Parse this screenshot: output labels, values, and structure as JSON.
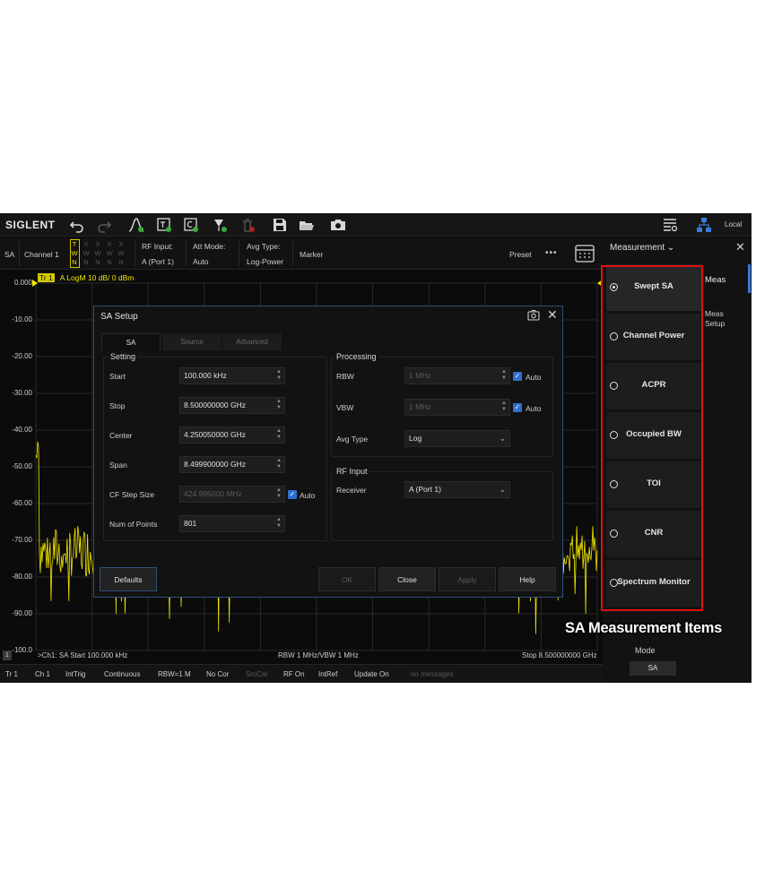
{
  "brand": "SIGLENT",
  "toolbar": {
    "local_label": "Local"
  },
  "channel_bar": {
    "mode": "SA",
    "channel": "Channel 1",
    "trace_grid": {
      "rows": [
        [
          "T",
          "X",
          "X",
          "X",
          "X"
        ],
        [
          "W",
          "W",
          "W",
          "W",
          "W"
        ],
        [
          "N",
          "N",
          "N",
          "N",
          "N"
        ]
      ],
      "active_column": 0
    },
    "rf_input_label": "RF Input:",
    "rf_input_value": "A (Port 1)",
    "att_mode_label": "Att Mode:",
    "att_mode_value": "Auto",
    "avg_type_label": "Avg Type:",
    "avg_type_value": "Log-Power",
    "marker_label": "Marker",
    "preset_label": "Preset",
    "more_label": "•••"
  },
  "trace_header": {
    "tag": "Tr 1",
    "text": "A  LogM  10 dB/  0 dBm"
  },
  "y_axis": {
    "ticks": [
      "0.000",
      "-10.00",
      "-20.00",
      "-30.00",
      "-40.00",
      "-50.00",
      "-60.00",
      "-70.00",
      "-80.00",
      "-90.00",
      "-100.0"
    ],
    "top_db": 0,
    "bottom_db": -100
  },
  "plot_footer": {
    "badge": "1",
    "start": ">Ch1: SA Start 100.000 kHz",
    "center": "RBW 1 MHz/VBW 1 MHz",
    "stop": "Stop 8.500000000 GHz"
  },
  "status_bar": [
    "Tr 1",
    "Ch 1",
    "IntTrig",
    "Continuous",
    "RBW=1 M",
    "No Cor",
    "SrcCal",
    "RF On",
    "IntRef",
    "Update On",
    "no messages"
  ],
  "dialog": {
    "title": "SA Setup",
    "tabs": [
      "SA",
      "Source",
      "Advanced"
    ],
    "setting": {
      "title": "Setting",
      "start_label": "Start",
      "start_value": "100.000 kHz",
      "stop_label": "Stop",
      "stop_value": "8.500000000 GHz",
      "center_label": "Center",
      "center_value": "4.250050000 GHz",
      "span_label": "Span",
      "span_value": "8.499900000 GHz",
      "cfstep_label": "CF Step Size",
      "cfstep_value": "424.995000 MHz",
      "cfstep_auto": "Auto",
      "points_label": "Num of Points",
      "points_value": "801"
    },
    "processing": {
      "title": "Processing",
      "rbw_label": "RBW",
      "rbw_value": "1 MHz",
      "rbw_auto": "Auto",
      "vbw_label": "VBW",
      "vbw_value": "1 MHz",
      "vbw_auto": "Auto",
      "avg_label": "Avg Type",
      "avg_value": "Log"
    },
    "rf_input": {
      "title": "RF Input",
      "receiver_label": "Receiver",
      "receiver_value": "A (Port 1)"
    },
    "buttons": {
      "defaults": "Defaults",
      "ok": "OK",
      "close": "Close",
      "apply": "Apply",
      "help": "Help"
    }
  },
  "measurement_panel": {
    "title": "Measurement ⌄",
    "items": [
      {
        "label": "Swept SA",
        "selected": true
      },
      {
        "label": "Channel Power",
        "selected": false
      },
      {
        "label": "ACPR",
        "selected": false
      },
      {
        "label": "Occupied BW",
        "selected": false
      },
      {
        "label": "TOI",
        "selected": false
      },
      {
        "label": "CNR",
        "selected": false
      },
      {
        "label": "Spectrum Monitor",
        "selected": false
      }
    ],
    "side_tabs": {
      "meas": "Meas",
      "meas_setup_line1": "Meas",
      "meas_setup_line2": "Setup"
    },
    "mode_label": "Mode",
    "mode_value": "SA"
  },
  "annotation": {
    "text": "SA Measurement Items",
    "color": "#e01010"
  },
  "colors": {
    "trace": "#f2e600",
    "accent": "#3a7bd5",
    "background": "#0b0b0b"
  }
}
